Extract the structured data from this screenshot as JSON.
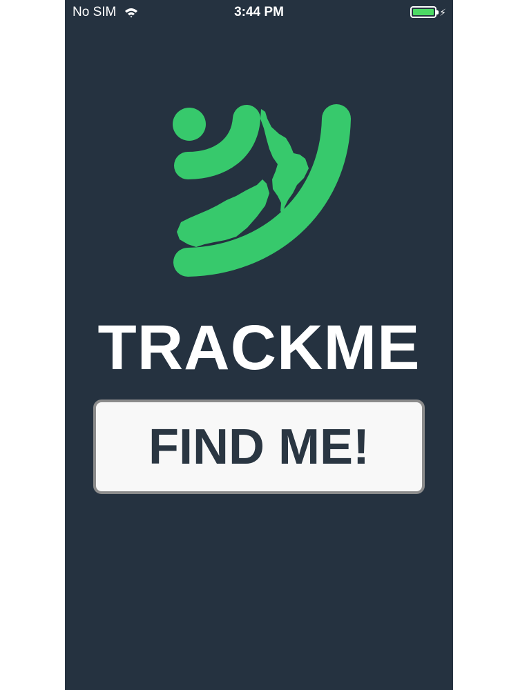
{
  "status_bar": {
    "carrier": "No SIM",
    "time": "3:44 PM",
    "wifi_icon": "wifi-icon",
    "battery_icon": "battery-icon",
    "charging_icon": "bolt-icon",
    "battery_color": "#4cd964"
  },
  "app": {
    "name": "TRACKME",
    "logo_icon": "trackme-signal-logo",
    "brand_color": "#37c96c",
    "background_color": "#253240"
  },
  "actions": {
    "find_me_label": "FIND ME!"
  }
}
